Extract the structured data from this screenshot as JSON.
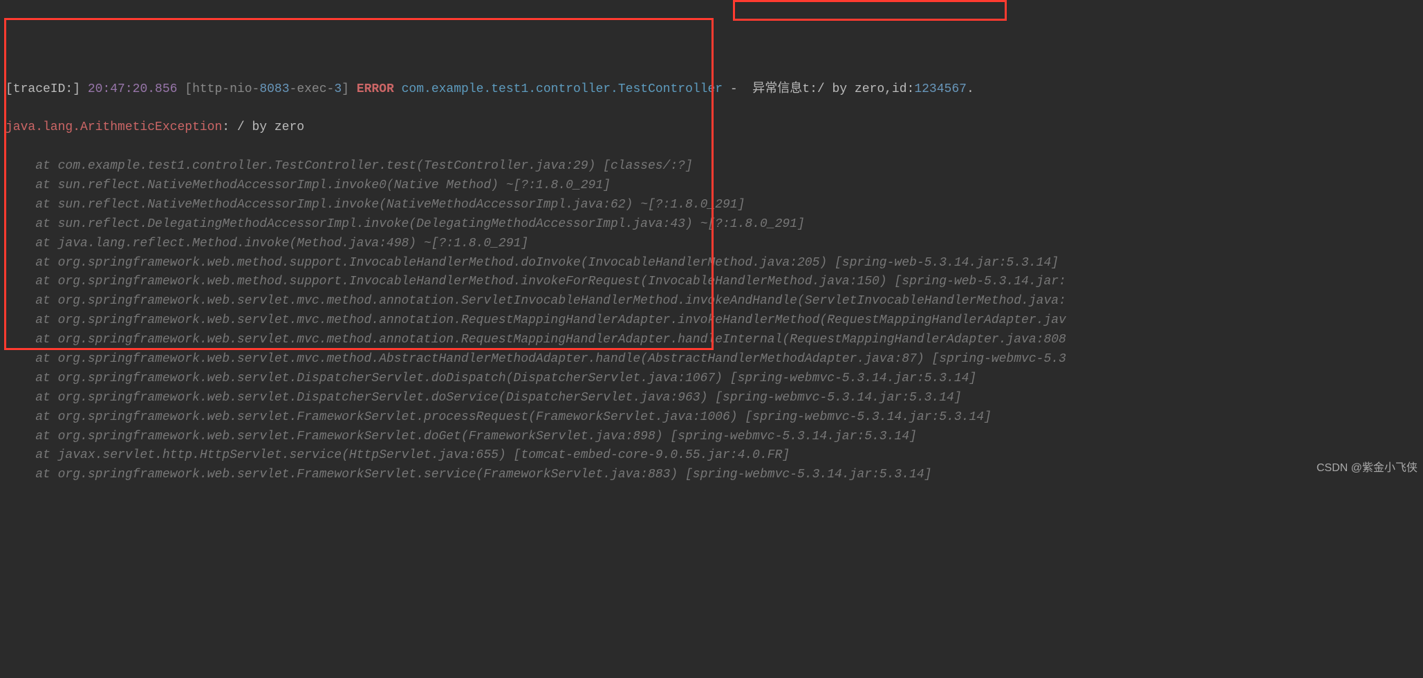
{
  "header": {
    "traceLabel": "[traceID:]",
    "timestamp": "20:47:20.856",
    "thread_pre": "[http-nio-",
    "thread_port": "8083",
    "thread_mid": "-exec-",
    "thread_num": "3",
    "thread_close": "]",
    "level": "ERROR",
    "logger": "com.example.test1.controller.TestController",
    "sep": " - ",
    "msg_prefix": " 异常信息t:/ by zero,id:",
    "id": "1234567",
    "msg_suffix": "."
  },
  "exception": {
    "class": "java.lang.ArithmeticException",
    "message": ": / by zero"
  },
  "stack": [
    "    at com.example.test1.controller.TestController.test(TestController.java:29) [classes/:?]",
    "    at sun.reflect.NativeMethodAccessorImpl.invoke0(Native Method) ~[?:1.8.0_291]",
    "    at sun.reflect.NativeMethodAccessorImpl.invoke(NativeMethodAccessorImpl.java:62) ~[?:1.8.0_291]",
    "    at sun.reflect.DelegatingMethodAccessorImpl.invoke(DelegatingMethodAccessorImpl.java:43) ~[?:1.8.0_291]",
    "    at java.lang.reflect.Method.invoke(Method.java:498) ~[?:1.8.0_291]",
    "    at org.springframework.web.method.support.InvocableHandlerMethod.doInvoke(InvocableHandlerMethod.java:205) [spring-web-5.3.14.jar:5.3.14]",
    "    at org.springframework.web.method.support.InvocableHandlerMethod.invokeForRequest(InvocableHandlerMethod.java:150) [spring-web-5.3.14.jar:",
    "    at org.springframework.web.servlet.mvc.method.annotation.ServletInvocableHandlerMethod.invokeAndHandle(ServletInvocableHandlerMethod.java:",
    "    at org.springframework.web.servlet.mvc.method.annotation.RequestMappingHandlerAdapter.invokeHandlerMethod(RequestMappingHandlerAdapter.jav",
    "    at org.springframework.web.servlet.mvc.method.annotation.RequestMappingHandlerAdapter.handleInternal(RequestMappingHandlerAdapter.java:808",
    "    at org.springframework.web.servlet.mvc.method.AbstractHandlerMethodAdapter.handle(AbstractHandlerMethodAdapter.java:87) [spring-webmvc-5.3",
    "    at org.springframework.web.servlet.DispatcherServlet.doDispatch(DispatcherServlet.java:1067) [spring-webmvc-5.3.14.jar:5.3.14]",
    "    at org.springframework.web.servlet.DispatcherServlet.doService(DispatcherServlet.java:963) [spring-webmvc-5.3.14.jar:5.3.14]",
    "    at org.springframework.web.servlet.FrameworkServlet.processRequest(FrameworkServlet.java:1006) [spring-webmvc-5.3.14.jar:5.3.14]",
    "    at org.springframework.web.servlet.FrameworkServlet.doGet(FrameworkServlet.java:898) [spring-webmvc-5.3.14.jar:5.3.14]",
    "    at javax.servlet.http.HttpServlet.service(HttpServlet.java:655) [tomcat-embed-core-9.0.55.jar:4.0.FR]",
    "    at org.springframework.web.servlet.FrameworkServlet.service(FrameworkServlet.java:883) [spring-webmvc-5.3.14.jar:5.3.14]"
  ],
  "watermark": "CSDN @紫金小飞侠"
}
